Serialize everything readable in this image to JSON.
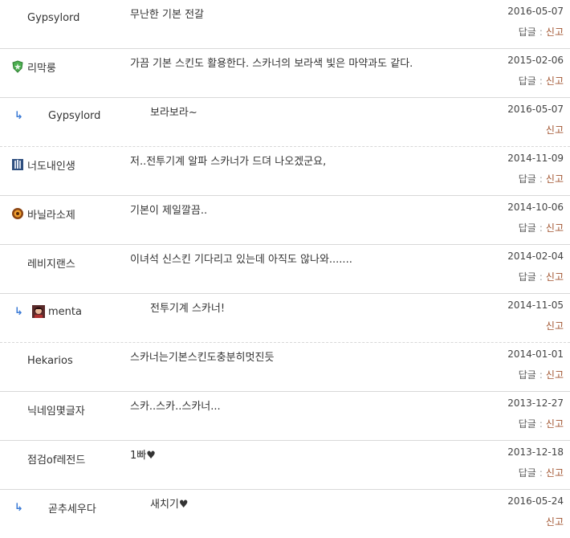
{
  "ui": {
    "reply_label": "답글",
    "report_label": "신고",
    "separator": ":",
    "reply_arrow": "↳"
  },
  "comments": [
    {
      "author": "Gypsylord",
      "body": "무난한 기본 전갈",
      "date": "2016-05-07",
      "is_reply": false,
      "badge": ""
    },
    {
      "author": "리막룽",
      "body": "가끔 기본 스킨도 활용한다. 스카너의 보라색 빛은 마약과도 같다.",
      "date": "2015-02-06",
      "is_reply": false,
      "badge": "shield"
    },
    {
      "author": "Gypsylord",
      "body": "보라보라~",
      "date": "2016-05-07",
      "is_reply": true,
      "badge": ""
    },
    {
      "author": "너도내인생",
      "body": "저..전투기계 알파 스카너가 드뎌 나오겠군요,",
      "date": "2014-11-09",
      "is_reply": false,
      "badge": "tower"
    },
    {
      "author": "바닐라소제",
      "body": "기본이 제일깔끔..",
      "date": "2014-10-06",
      "is_reply": false,
      "badge": "orb"
    },
    {
      "author": "레비지랜스",
      "body": "이녀석 신스킨 기다리고 있는데 아직도 않나와.......",
      "date": "2014-02-04",
      "is_reply": false,
      "badge": ""
    },
    {
      "author": "menta",
      "body": "전투기계 스카너!",
      "date": "2014-11-05",
      "is_reply": true,
      "badge": "avatar"
    },
    {
      "author": "Hekarios",
      "body": "스카너는기본스킨도충분히멋진듯",
      "date": "2014-01-01",
      "is_reply": false,
      "badge": ""
    },
    {
      "author": "닉네임몇글자",
      "body": "스카..스카..스카너...",
      "date": "2013-12-27",
      "is_reply": false,
      "badge": ""
    },
    {
      "author": "점검of레전드",
      "body": "1빠♥",
      "date": "2013-12-18",
      "is_reply": false,
      "badge": ""
    },
    {
      "author": "곧추세우다",
      "body": "새치기♥",
      "date": "2016-05-24",
      "is_reply": true,
      "badge": ""
    }
  ],
  "colors": {
    "text": "#333333",
    "report": "#a0522d",
    "reply_arrow": "#3b7bd6",
    "divider": "#d8d8d8"
  }
}
